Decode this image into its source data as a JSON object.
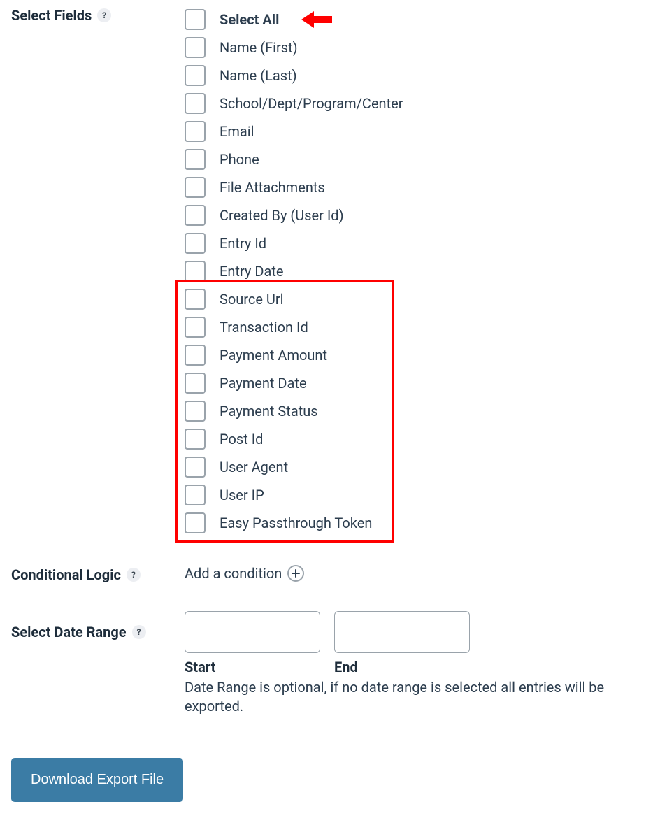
{
  "sections": {
    "select_fields": {
      "title": "Select Fields",
      "help": "?"
    },
    "conditional_logic": {
      "title": "Conditional Logic",
      "help": "?",
      "add_label": "Add a condition"
    },
    "date_range": {
      "title": "Select Date Range",
      "help": "?",
      "start_label": "Start",
      "end_label": "End",
      "note": "Date Range is optional, if no date range is selected all entries will be exported."
    }
  },
  "fields": [
    {
      "label": "Select All",
      "bold": true,
      "highlighted": false
    },
    {
      "label": "Name (First)",
      "bold": false,
      "highlighted": false
    },
    {
      "label": "Name (Last)",
      "bold": false,
      "highlighted": false
    },
    {
      "label": "School/Dept/Program/Center",
      "bold": false,
      "highlighted": false
    },
    {
      "label": "Email",
      "bold": false,
      "highlighted": false
    },
    {
      "label": "Phone",
      "bold": false,
      "highlighted": false
    },
    {
      "label": "File Attachments",
      "bold": false,
      "highlighted": false
    },
    {
      "label": "Created By (User Id)",
      "bold": false,
      "highlighted": false
    },
    {
      "label": "Entry Id",
      "bold": false,
      "highlighted": false
    },
    {
      "label": "Entry Date",
      "bold": false,
      "highlighted": false
    },
    {
      "label": "Source Url",
      "bold": false,
      "highlighted": true
    },
    {
      "label": "Transaction Id",
      "bold": false,
      "highlighted": true
    },
    {
      "label": "Payment Amount",
      "bold": false,
      "highlighted": true
    },
    {
      "label": "Payment Date",
      "bold": false,
      "highlighted": true
    },
    {
      "label": "Payment Status",
      "bold": false,
      "highlighted": true
    },
    {
      "label": "Post Id",
      "bold": false,
      "highlighted": true
    },
    {
      "label": "User Agent",
      "bold": false,
      "highlighted": true
    },
    {
      "label": "User IP",
      "bold": false,
      "highlighted": true
    },
    {
      "label": "Easy Passthrough Token",
      "bold": false,
      "highlighted": true
    }
  ],
  "buttons": {
    "download": "Download Export File"
  },
  "annotations": {
    "arrow_color": "#ff0000",
    "box_color": "#ff0000"
  }
}
